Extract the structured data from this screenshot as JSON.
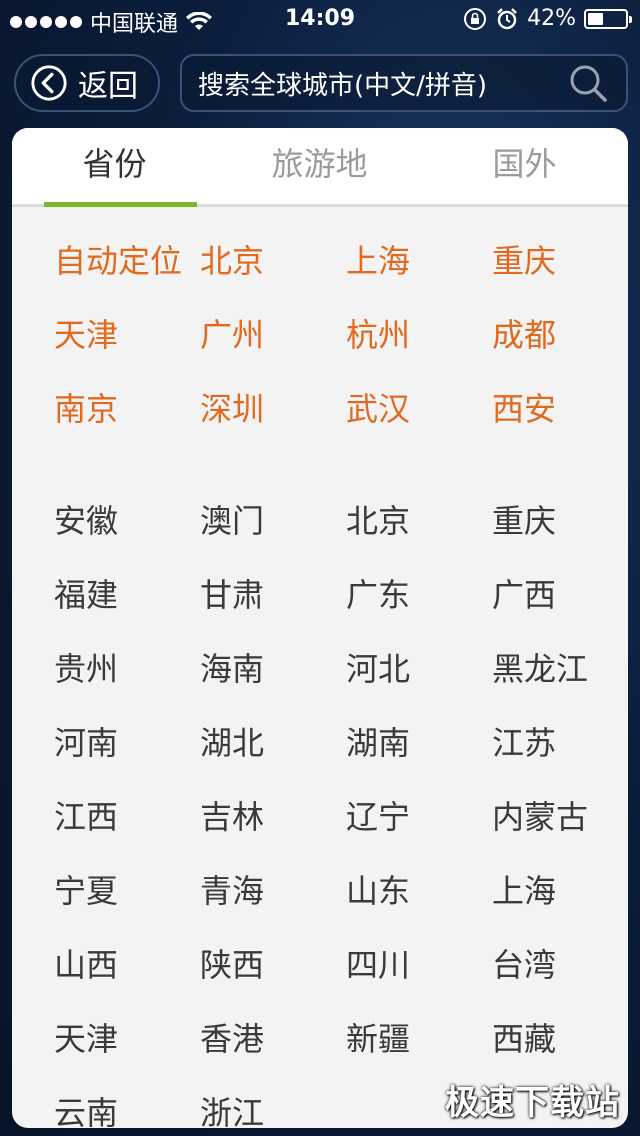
{
  "status_bar": {
    "carrier": "中国联通",
    "time": "14:09",
    "battery": "42%",
    "battery_level": 0.42
  },
  "header": {
    "back_label": "返回",
    "search_placeholder": "搜索全球城市(中文/拼音)"
  },
  "tabs": [
    {
      "label": "省份",
      "active": true
    },
    {
      "label": "旅游地",
      "active": false
    },
    {
      "label": "国外",
      "active": false
    }
  ],
  "hot_rows": [
    [
      "自动定位",
      "北京",
      "上海",
      "重庆"
    ],
    [
      "天津",
      "广州",
      "杭州",
      "成都"
    ],
    [
      "南京",
      "深圳",
      "武汉",
      "西安"
    ]
  ],
  "province_rows": [
    [
      "安徽",
      "澳门",
      "北京",
      "重庆"
    ],
    [
      "福建",
      "甘肃",
      "广东",
      "广西"
    ],
    [
      "贵州",
      "海南",
      "河北",
      "黑龙江"
    ],
    [
      "河南",
      "湖北",
      "湖南",
      "江苏"
    ],
    [
      "江西",
      "吉林",
      "辽宁",
      "内蒙古"
    ],
    [
      "宁夏",
      "青海",
      "山东",
      "上海"
    ],
    [
      "山西",
      "陕西",
      "四川",
      "台湾"
    ],
    [
      "天津",
      "香港",
      "新疆",
      "西藏"
    ],
    [
      "云南",
      "浙江"
    ]
  ],
  "watermark": "极速下载站",
  "colors": {
    "accent_green": "#7cb82f",
    "hot_city_orange": "#e06a1e",
    "province_text": "#3a3a3a"
  }
}
